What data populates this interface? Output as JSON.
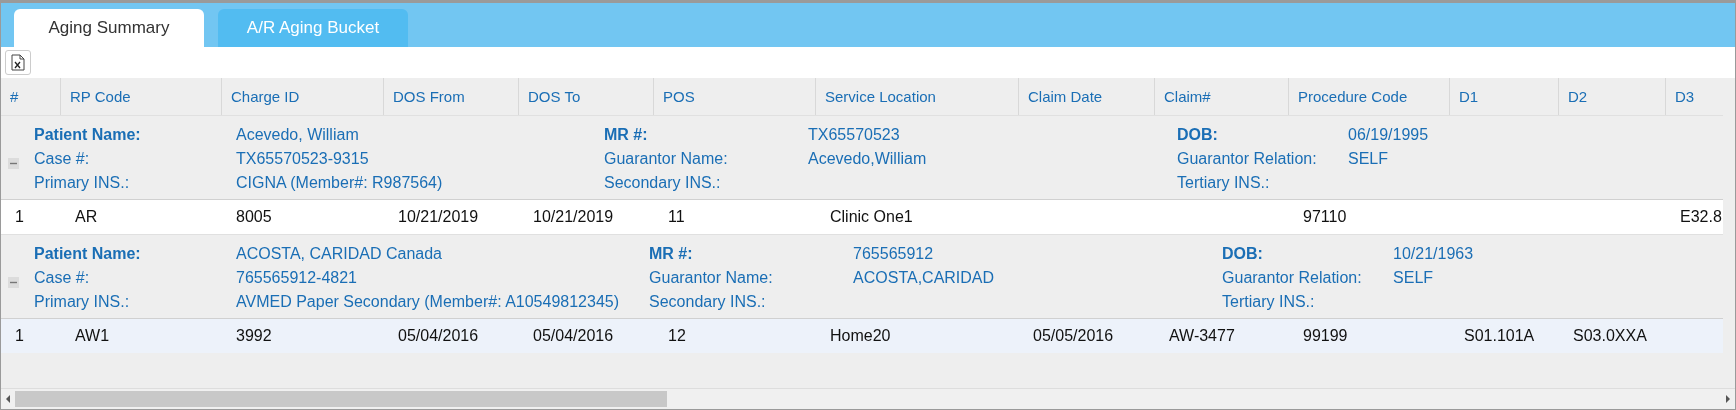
{
  "tabs": [
    {
      "label": "Aging Summary",
      "selected": true
    },
    {
      "label": "A/R Aging Bucket",
      "selected": false
    }
  ],
  "table": {
    "columns": [
      "#",
      "RP Code",
      "Charge ID",
      "DOS From",
      "DOS To",
      "POS",
      "Service Location",
      "Claim Date",
      "Claim#",
      "Procedure Code",
      "D1",
      "D2",
      "D3"
    ],
    "groups": [
      {
        "expanded": true,
        "fields": [
          {
            "label": "Patient Name:",
            "value": "Acevedo, William"
          },
          {
            "label": "MR #:",
            "value": "TX65570523"
          },
          {
            "label": "DOB:",
            "value": "06/19/1995"
          },
          {
            "label": "Case #:",
            "value": "TX65570523-9315"
          },
          {
            "label": "Guarantor Name:",
            "value": "Acevedo,William"
          },
          {
            "label": "Guarantor Relation:",
            "value": "SELF"
          },
          {
            "label": "Primary INS.:",
            "value": "CIGNA (Member#: R987564)"
          },
          {
            "label": "Secondary INS.:"
          },
          {
            "label": "Tertiary INS.:"
          }
        ],
        "rows": [
          {
            "selected": false,
            "cells": [
              "1",
              "AR",
              "8005",
              "10/21/2019",
              "10/21/2019",
              "11",
              "Clinic One1",
              null,
              null,
              "97110",
              null,
              null,
              "E32.8"
            ]
          }
        ]
      },
      {
        "expanded": true,
        "fields": [
          {
            "label": "Patient Name:",
            "value": "ACOSTA, CARIDAD Canada"
          },
          {
            "label": "MR #:",
            "value": "765565912"
          },
          {
            "label": "DOB:",
            "value": "10/21/1963"
          },
          {
            "label": "Case #:",
            "value": "765565912-4821"
          },
          {
            "label": "Guarantor Name:",
            "value": "ACOSTA,CARIDAD"
          },
          {
            "label": "Guarantor Relation:",
            "value": "SELF"
          },
          {
            "label": "Primary INS.:",
            "value": "AVMED Paper Secondary (Member#: A10549812345)"
          },
          {
            "label": "Secondary INS.:"
          },
          {
            "label": "Tertiary INS.:"
          }
        ],
        "rows": [
          {
            "selected": true,
            "cells": [
              "1",
              "AW1",
              "3992",
              "05/04/2016",
              "05/04/2016",
              "12",
              "Home20",
              "05/05/2016",
              "AW-3477",
              "99199",
              "S01.101A",
              "S03.0XXA",
              null
            ]
          }
        ]
      }
    ]
  }
}
